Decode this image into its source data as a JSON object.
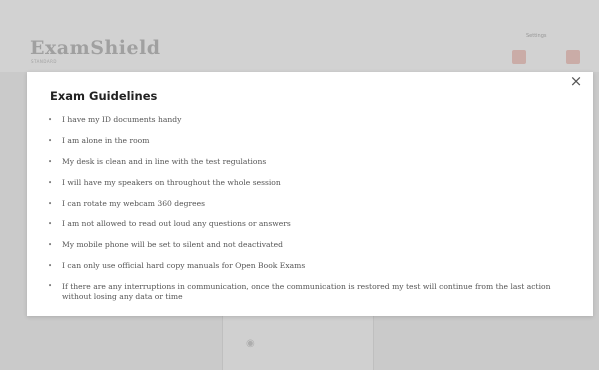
{
  "app": {
    "logo_text": "ExamShield",
    "logo_subtext": "STANDARD",
    "settings_link": "Settings"
  },
  "modal": {
    "title": "Exam Guidelines",
    "close_glyph": "×",
    "guidelines": [
      "I have my ID documents handy",
      "I am alone in the room",
      "My desk is clean and in line with the test regulations",
      "I will have my speakers on throughout the whole session",
      "I can rotate my webcam 360 degrees",
      "I am not allowed to read out loud any questions or answers",
      "My mobile phone will be set to silent and not deactivated",
      "I can only use official hard copy manuals for Open Book Exams",
      "If there are any interruptions in communication, once the communication is restored my test will continue from the last action without losing any data or time"
    ]
  },
  "icons": {
    "close": "close-icon",
    "bullet": "bullet-icon"
  },
  "colors": {
    "accent": "#d9534f",
    "modal_bg": "#ffffff",
    "backdrop": "#dcdcdc"
  }
}
